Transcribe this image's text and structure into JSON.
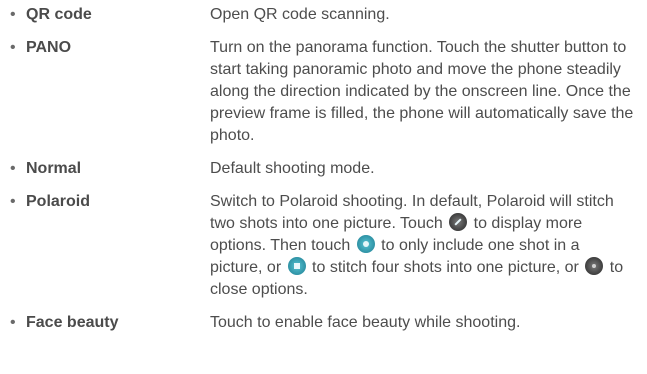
{
  "items": [
    {
      "bullet": "•",
      "term": "QR code",
      "desc": "Open QR code scanning."
    },
    {
      "bullet": "•",
      "term": "PANO",
      "desc": "Turn on the panorama function. Touch the shutter button to start taking panoramic photo and move the phone steadily along the direction indicated by the onscreen line. Once the preview frame is filled, the phone will automatically save the photo."
    },
    {
      "bullet": "•",
      "term": "Normal",
      "desc": "Default shooting mode."
    },
    {
      "bullet": "•",
      "term": "Polaroid",
      "desc_parts": [
        "Switch to Polaroid shooting. In default, Polaroid will stitch two shots into one picture. Touch ",
        " to display more options. Then touch ",
        " to only include one shot in a picture, or ",
        " to stitch four shots into one picture, or ",
        " to close options."
      ],
      "icons": [
        "polaroid-options-icon",
        "single-shot-icon",
        "four-shot-icon",
        "close-options-icon"
      ]
    },
    {
      "bullet": "•",
      "term": "Face beauty",
      "desc": "Touch to enable face beauty while shooting."
    }
  ]
}
